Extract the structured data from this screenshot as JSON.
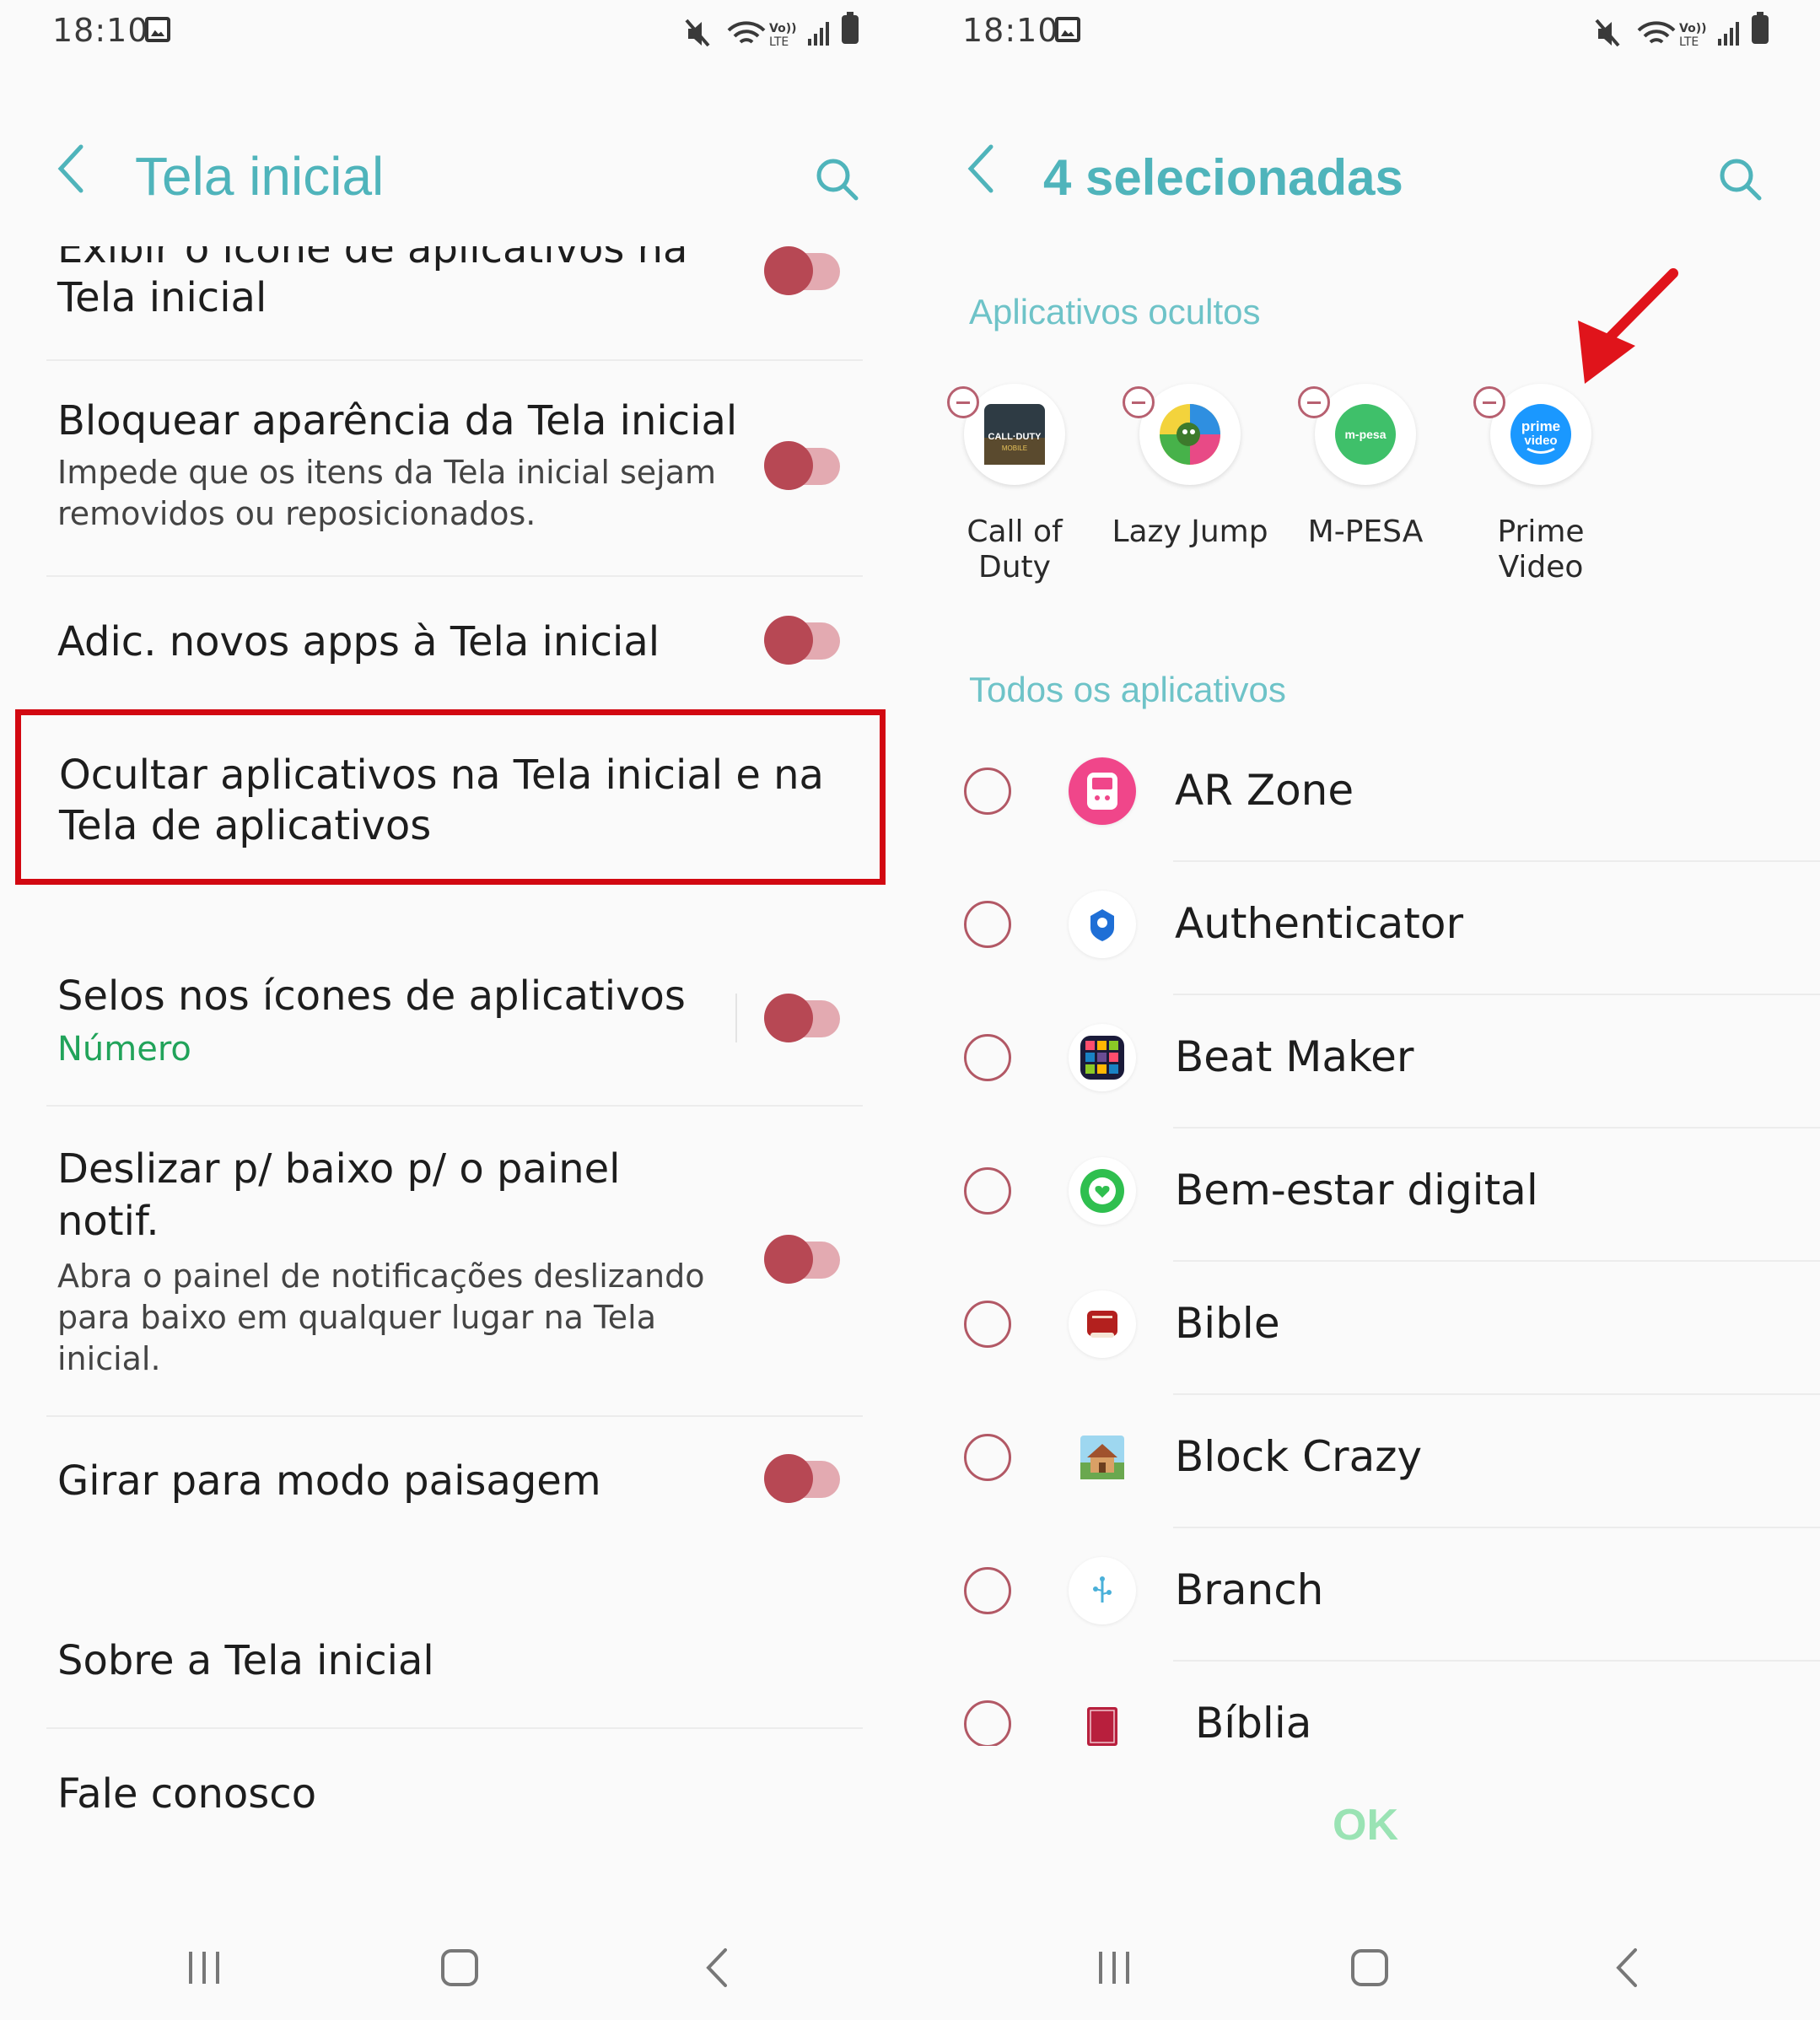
{
  "status_bar": {
    "time": "18:10",
    "volte_label": "Vo)) LTE"
  },
  "left": {
    "header": {
      "title": "Tela inicial"
    },
    "items": [
      {
        "title_partial_top": "Exibir o ícone de aplicativos na",
        "title": "Tela inicial",
        "toggle_on": true
      },
      {
        "title": "Bloquear aparência da Tela inicial",
        "subtitle_line1": "Impede que os itens da Tela inicial sejam",
        "subtitle_line2": "removidos ou reposicionados.",
        "toggle_on": true
      },
      {
        "title": "Adic. novos apps à Tela inicial",
        "toggle_on": true
      },
      {
        "title_line1": "Ocultar aplicativos na Tela inicial e na",
        "title_line2": "Tela de aplicativos"
      },
      {
        "title": "Selos nos ícones de aplicativos",
        "subtitle": "Número",
        "toggle_on": true
      },
      {
        "title_line1": "Deslizar p/ baixo p/ o painel",
        "title_line2": "notif.",
        "subtitle_line1": "Abra o painel de notificações deslizando",
        "subtitle_line2": "para baixo em qualquer lugar na Tela",
        "subtitle_line3": "inicial.",
        "toggle_on": true
      },
      {
        "title": "Girar para modo paisagem",
        "toggle_on": true
      },
      {
        "title": "Sobre a Tela inicial"
      },
      {
        "title": "Fale conosco"
      }
    ],
    "highlight_color": "#d20811",
    "subtitle_accent_color": "#21a35a"
  },
  "right": {
    "header": {
      "title": "4 selecionadas"
    },
    "hidden_section_label": "Aplicativos ocultos",
    "hidden_apps": [
      {
        "name_line1": "Call of",
        "name_line2": "Duty",
        "icon": "call-of-duty-icon",
        "icon_text_line1": "CALL·DUTY",
        "icon_text_line2": "MOBILE"
      },
      {
        "name_line1": "Lazy Jump",
        "name_line2": "",
        "icon": "lazy-jump-icon"
      },
      {
        "name_line1": "M-PESA",
        "name_line2": "",
        "icon": "mpesa-icon",
        "icon_text_line1": "m-pesa"
      },
      {
        "name_line1": "Prime",
        "name_line2": "Video",
        "icon": "prime-video-icon",
        "icon_text_line1": "prime",
        "icon_text_line2": "video"
      }
    ],
    "all_section_label": "Todos os aplicativos",
    "all_apps": [
      {
        "name": "AR Zone",
        "icon": "ar-zone-icon"
      },
      {
        "name": "Authenticator",
        "icon": "authenticator-icon"
      },
      {
        "name": "Beat Maker",
        "icon": "beat-maker-icon"
      },
      {
        "name": "Bem-estar digital",
        "icon": "digital-wellbeing-icon"
      },
      {
        "name": "Bible",
        "icon": "bible-icon"
      },
      {
        "name": "Block Crazy",
        "icon": "block-crazy-icon"
      },
      {
        "name": "Branch",
        "icon": "branch-icon"
      },
      {
        "name": "Bíblia",
        "icon": "biblia-icon"
      }
    ],
    "ok_label": "OK",
    "arrow_color": "#e0141b"
  },
  "nav": {
    "recents": "|||",
    "home": "▢",
    "back": "‹"
  },
  "accent_color": "#4fb4bb"
}
